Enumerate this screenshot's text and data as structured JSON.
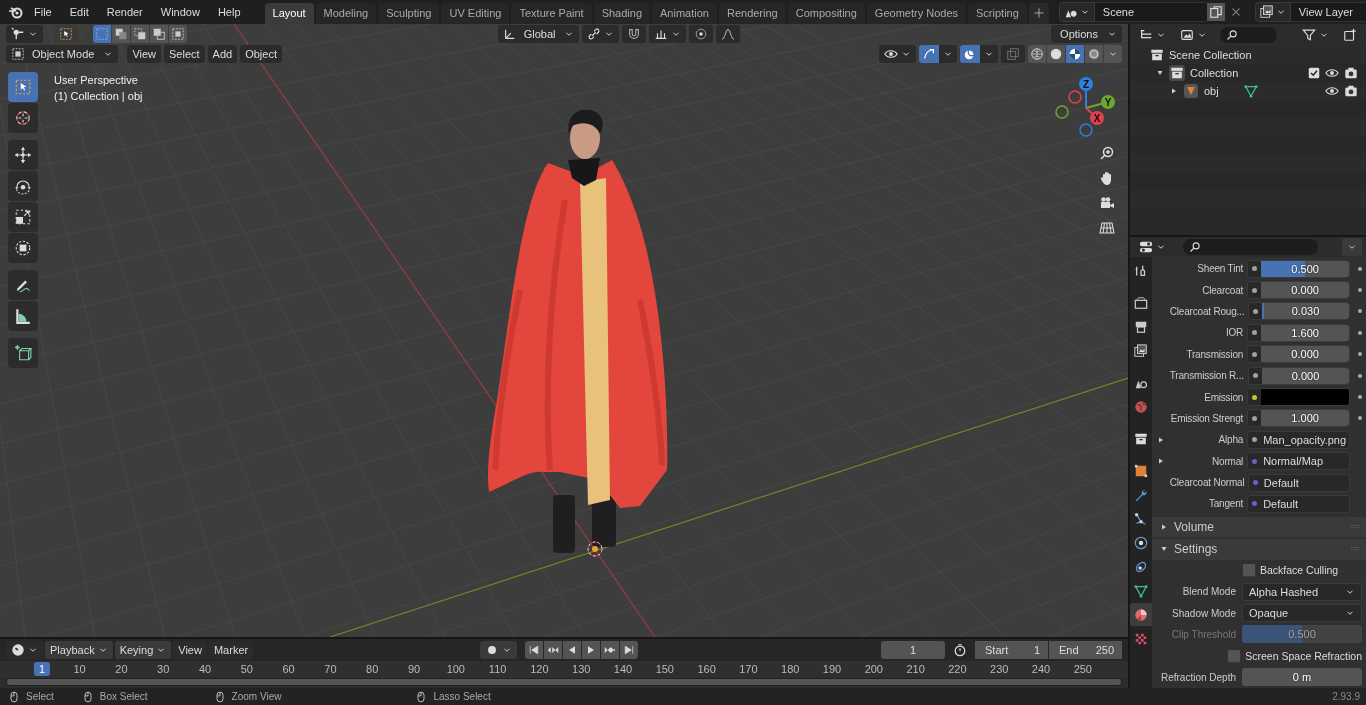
{
  "top_bar": {
    "menus": [
      "File",
      "Edit",
      "Render",
      "Window",
      "Help"
    ],
    "workspace_tabs": [
      {
        "label": "Layout",
        "selected": true
      },
      {
        "label": "Modeling",
        "selected": false
      },
      {
        "label": "Sculpting",
        "selected": false
      },
      {
        "label": "UV Editing",
        "selected": false
      },
      {
        "label": "Texture Paint",
        "selected": false
      },
      {
        "label": "Shading",
        "selected": false
      },
      {
        "label": "Animation",
        "selected": false
      },
      {
        "label": "Rendering",
        "selected": false
      },
      {
        "label": "Compositing",
        "selected": false
      },
      {
        "label": "Geometry Nodes",
        "selected": false
      },
      {
        "label": "Scripting",
        "selected": false
      }
    ],
    "scene": "Scene",
    "view_layer": "View Layer"
  },
  "viewport": {
    "select_modes": [
      {
        "selected": true
      },
      {
        "selected": false
      },
      {
        "selected": false
      },
      {
        "selected": false
      },
      {
        "selected": false
      }
    ],
    "orientation": "Global",
    "options": "Options",
    "mode": "Object Mode",
    "menus": [
      "View",
      "Select",
      "Add",
      "Object"
    ],
    "shading_modes": [
      {
        "selected": false
      },
      {
        "selected": false
      },
      {
        "selected": true
      },
      {
        "selected": false
      }
    ],
    "overlay_text": [
      "User Perspective",
      "(1) Collection | obj"
    ],
    "tools": [
      {
        "kind": "select-box",
        "selected": true
      },
      {
        "kind": "cursor",
        "selected": false
      },
      {
        "kind": "move",
        "selected": false
      },
      {
        "kind": "rotate",
        "selected": false
      },
      {
        "kind": "scale",
        "selected": false
      },
      {
        "kind": "transform",
        "selected": false
      },
      {
        "kind": "annotate",
        "selected": false
      },
      {
        "kind": "measure",
        "selected": false
      },
      {
        "kind": "add-cube",
        "selected": false
      }
    ],
    "axes": [
      "Z",
      "Y",
      "X"
    ]
  },
  "timeline": {
    "menus": [
      "Playback",
      "Keying",
      "View",
      "Marker"
    ],
    "auto_keying": {
      "on": false
    },
    "current_frame": "1",
    "start_label": "Start",
    "start": "1",
    "end_label": "End",
    "end": "250",
    "ruler": [
      {
        "label": "1",
        "selected": true
      },
      {
        "label": "10",
        "selected": false
      },
      {
        "label": "20",
        "selected": false
      },
      {
        "label": "30",
        "selected": false
      },
      {
        "label": "40",
        "selected": false
      },
      {
        "label": "50",
        "selected": false
      },
      {
        "label": "60",
        "selected": false
      },
      {
        "label": "70",
        "selected": false
      },
      {
        "label": "80",
        "selected": false
      },
      {
        "label": "90",
        "selected": false
      },
      {
        "label": "100",
        "selected": false
      },
      {
        "label": "110",
        "selected": false
      },
      {
        "label": "120",
        "selected": false
      },
      {
        "label": "130",
        "selected": false
      },
      {
        "label": "140",
        "selected": false
      },
      {
        "label": "150",
        "selected": false
      },
      {
        "label": "160",
        "selected": false
      },
      {
        "label": "170",
        "selected": false
      },
      {
        "label": "180",
        "selected": false
      },
      {
        "label": "190",
        "selected": false
      },
      {
        "label": "200",
        "selected": false
      },
      {
        "label": "210",
        "selected": false
      },
      {
        "label": "220",
        "selected": false
      },
      {
        "label": "230",
        "selected": false
      },
      {
        "label": "240",
        "selected": false
      },
      {
        "label": "250",
        "selected": false
      }
    ]
  },
  "outliner": {
    "items": [
      {
        "name": "Scene Collection",
        "children": [
          {
            "name": "Collection",
            "expanded": true,
            "checked": true,
            "children": [
              {
                "name": "obj",
                "expanded": false
              }
            ]
          }
        ]
      }
    ]
  },
  "properties": {
    "tabs": [
      {
        "kind": "tool",
        "selected": false
      },
      {
        "kind": "render",
        "selected": false
      },
      {
        "kind": "output",
        "selected": false
      },
      {
        "kind": "view-layer",
        "selected": false
      },
      {
        "kind": "scene",
        "selected": false
      },
      {
        "kind": "world",
        "selected": false
      },
      {
        "kind": "collection",
        "selected": false
      },
      {
        "kind": "object",
        "selected": false
      },
      {
        "kind": "modifier",
        "selected": false
      },
      {
        "kind": "particles",
        "selected": false
      },
      {
        "kind": "physics",
        "selected": false
      },
      {
        "kind": "constraints",
        "selected": false
      },
      {
        "kind": "data",
        "selected": false
      },
      {
        "kind": "material",
        "selected": true
      },
      {
        "kind": "texture",
        "selected": false
      }
    ],
    "rows": [
      {
        "kind": "slider",
        "label": "Sheen Tint",
        "value": "0.500",
        "level": 0.5,
        "socket": {
          "color": "#a1a1a1"
        }
      },
      {
        "kind": "slider",
        "label": "Clearcoat",
        "value": "0.000",
        "level": 0,
        "socket": {
          "color": "#a1a1a1"
        }
      },
      {
        "kind": "slider",
        "label": "Clearcoat Roug...",
        "value": "0.030",
        "level": 0.03,
        "socket": {
          "color": "#a1a1a1"
        }
      },
      {
        "kind": "number",
        "label": "IOR",
        "value": "1.600",
        "socket": {
          "color": "#a1a1a1"
        }
      },
      {
        "kind": "slider",
        "label": "Transmission",
        "value": "0.000",
        "level": 0,
        "socket": {
          "color": "#a1a1a1"
        }
      },
      {
        "kind": "slider",
        "label": "Transmission R...",
        "value": "0.000",
        "level": 0,
        "socket": {
          "color": "#a1a1a1"
        }
      },
      {
        "kind": "color",
        "label": "Emission",
        "color": "#000000",
        "socket": {
          "color": "#c7c729"
        }
      },
      {
        "kind": "number",
        "label": "Emission Strengt",
        "value": "1.000",
        "socket": {
          "color": "#a1a1a1"
        }
      },
      {
        "kind": "link",
        "label": "Alpha",
        "value": "Man_opacity.png",
        "expanded": false,
        "socket": {
          "color": "#a1a1a1"
        }
      },
      {
        "kind": "link",
        "label": "Normal",
        "value": "Normal/Map",
        "expanded": false,
        "socket": {
          "color": "#6363c7"
        }
      },
      {
        "kind": "link",
        "label": "Clearcoat Normal",
        "value": "Default",
        "socket": {
          "color": "#6363c7"
        }
      },
      {
        "kind": "link",
        "label": "Tangent",
        "value": "Default",
        "socket": {
          "color": "#6363c7"
        }
      },
      {
        "kind": "panel",
        "label": "Volume",
        "expanded": false
      },
      {
        "kind": "panel",
        "label": "Settings",
        "expanded": true
      },
      {
        "kind": "checkbox",
        "label": "Backface Culling",
        "checked": false
      },
      {
        "kind": "dropdown",
        "label": "Blend Mode",
        "value": "Alpha Hashed"
      },
      {
        "kind": "dropdown",
        "label": "Shadow Mode",
        "value": "Opaque"
      },
      {
        "kind": "setting-slider",
        "label": "Clip Threshold",
        "value": "0.500",
        "level": 0.5,
        "disabled": true
      },
      {
        "kind": "checkbox",
        "label": "Screen Space Refraction",
        "checked": false
      },
      {
        "kind": "setting-slider",
        "label": "Refraction Depth",
        "value": "0 m",
        "level": 0,
        "disabled": false
      }
    ]
  },
  "status_bar": {
    "hints": [
      "Select",
      "Box Select",
      "Zoom View",
      "Lasso Select"
    ],
    "version": "2.93.9"
  }
}
